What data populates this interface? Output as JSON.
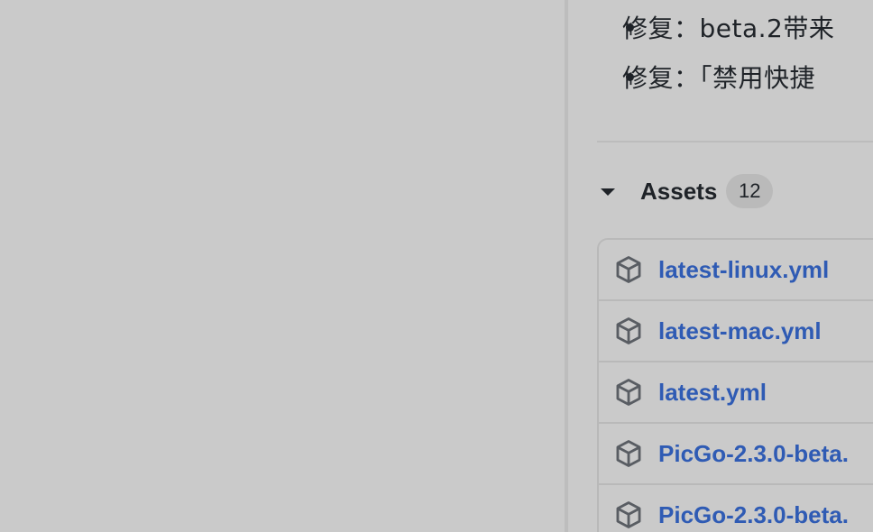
{
  "release_notes": [
    "修复：beta.2带来",
    "修复：「禁用快捷"
  ],
  "assets": {
    "title": "Assets",
    "count": "12",
    "files": [
      "latest-linux.yml",
      "latest-mac.yml",
      "latest.yml",
      "PicGo-2.3.0-beta.",
      "PicGo-2.3.0-beta."
    ]
  },
  "icons": {
    "bullet": "bullet-dot",
    "assets_toggle": "caret-down-icon",
    "file": "package-icon"
  },
  "colors": {
    "link": "#2f5bb4",
    "text": "#1f2328",
    "background": "#cacaca",
    "border": "#b9b9b9"
  }
}
